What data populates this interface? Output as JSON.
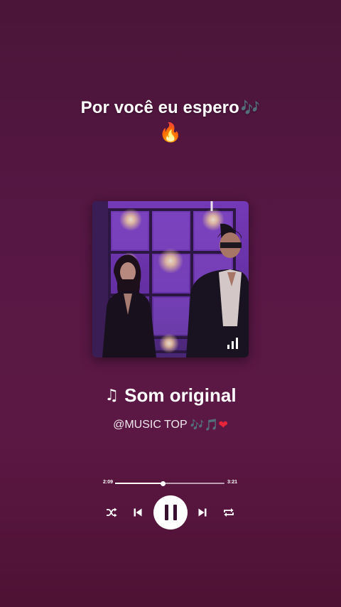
{
  "caption": {
    "text": "Por você eu espero",
    "emoji": "🎶",
    "emoji_line2": "🔥"
  },
  "album": {
    "description_icon": "equalizer-icon"
  },
  "song": {
    "note_icon": "♫",
    "title": "Som original",
    "artist": "@MUSIC TOP",
    "artist_emojis": [
      "🎶",
      "🎵",
      "❤"
    ]
  },
  "player": {
    "elapsed": "2:09",
    "total": "3:21",
    "progress": 0.44,
    "controls": {
      "shuffle_icon": "shuffle-icon",
      "prev_icon": "skip-previous-icon",
      "play_pause_icon": "pause-icon",
      "next_icon": "skip-next-icon",
      "repeat_icon": "repeat-icon"
    }
  },
  "colors": {
    "background_top": "#4a1538",
    "background_bottom": "#4e1234",
    "accent_white": "#ffffff"
  }
}
